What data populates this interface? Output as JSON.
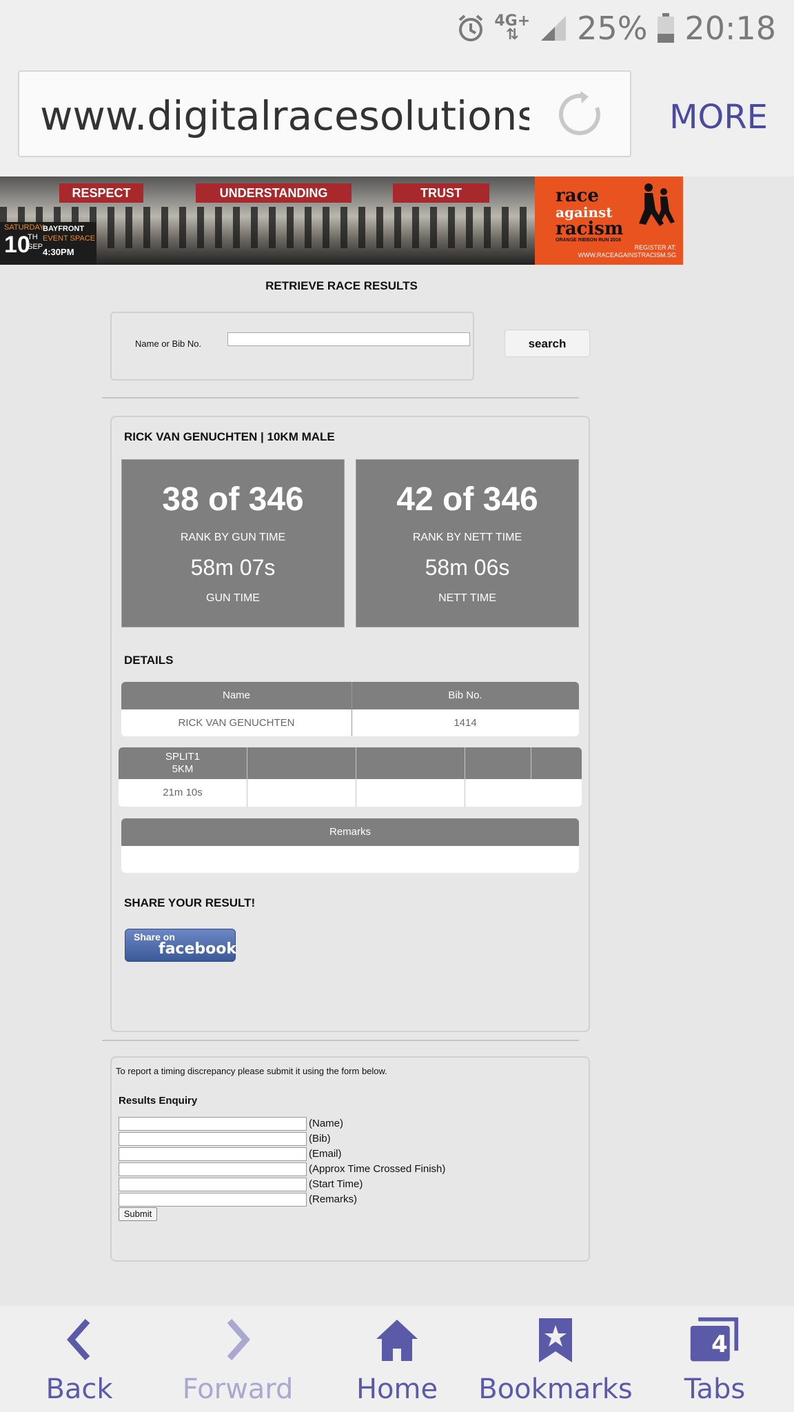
{
  "status_bar": {
    "network": "4G+",
    "battery": "25%",
    "time": "20:18"
  },
  "browser": {
    "url": "www.digitalracesolutions.c",
    "more_label": "MORE"
  },
  "banner": {
    "flags": [
      "RESPECT",
      "UNDERSTANDING",
      "TRUST"
    ],
    "day": "SATURDAY",
    "date_num": "10",
    "date_suffix": "TH",
    "month": "SEP",
    "venue_line1": "BAYFRONT",
    "venue_line2": "EVENT SPACE",
    "time": "4:30PM",
    "logo_line1": "race",
    "logo_line2": "against",
    "logo_line3": "racism",
    "logo_sub": "ORANGE RIBBON RUN 2016",
    "register": "REGISTER AT:",
    "register_url": "WWW.RACEAGAINSTRACISM.SG"
  },
  "page": {
    "title": "RETRIEVE RACE RESULTS"
  },
  "search": {
    "label": "Name or Bib No.",
    "value": "",
    "button": "search"
  },
  "result": {
    "title": "RICK VAN GENUCHTEN | 10KM MALE",
    "gun": {
      "rank": "38 of 346",
      "rank_label": "RANK BY GUN TIME",
      "time": "58m 07s",
      "time_label": "GUN TIME"
    },
    "nett": {
      "rank": "42 of 346",
      "rank_label": "RANK BY NETT TIME",
      "time": "58m 06s",
      "time_label": "NETT TIME"
    }
  },
  "details": {
    "title": "DETAILS",
    "headers": [
      "Name",
      "Bib No."
    ],
    "row": [
      "RICK VAN GENUCHTEN",
      "1414"
    ]
  },
  "splits": {
    "header_line1": "SPLIT1",
    "header_line2": "5KM",
    "value": "21m 10s"
  },
  "remarks": {
    "header": "Remarks",
    "value": ""
  },
  "share": {
    "title": "SHARE YOUR RESULT!",
    "fb_small": "Share on",
    "fb_big": "facebook"
  },
  "enquiry": {
    "intro": "To report a timing discrepancy please submit it using the form below.",
    "title": "Results Enquiry",
    "fields": [
      "(Name)",
      "(Bib)",
      "(Email)",
      "(Approx Time Crossed Finish)",
      "(Start Time)",
      "(Remarks)"
    ],
    "submit": "Submit"
  },
  "bottom_nav": {
    "items": [
      {
        "label": "Back",
        "icon": "back-chevron-icon"
      },
      {
        "label": "Forward",
        "icon": "forward-chevron-icon"
      },
      {
        "label": "Home",
        "icon": "home-icon"
      },
      {
        "label": "Bookmarks",
        "icon": "bookmark-star-icon"
      },
      {
        "label": "Tabs",
        "icon": "tabs-icon"
      }
    ],
    "tab_count": "4",
    "colors": {
      "active": "#5a5aa8",
      "disabled": "#a9a8d0"
    }
  }
}
